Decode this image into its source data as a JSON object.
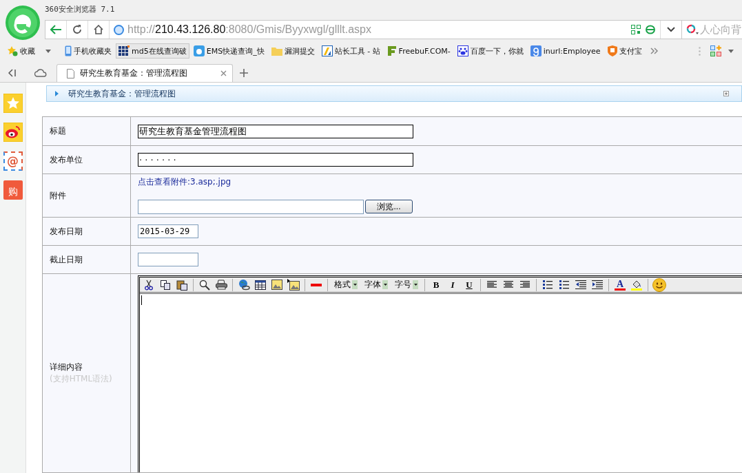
{
  "window": {
    "title": "360安全浏览器 7.1"
  },
  "address_bar": {
    "scheme": "http://",
    "host": "210.43.126.80",
    "path": ":8080/Gmis/Byyxwgl/glllt.aspx"
  },
  "search": {
    "placeholder": "人心向背"
  },
  "bookmarks": [
    {
      "label": "收藏",
      "kind": "favorites",
      "selected": false
    },
    {
      "label": "手机收藏夹",
      "kind": "phone",
      "selected": false
    },
    {
      "label": "md5在线查询破",
      "kind": "grid",
      "selected": true
    },
    {
      "label": "EMS快递查询_快",
      "kind": "ems",
      "selected": false
    },
    {
      "label": "漏洞提交",
      "kind": "folder",
      "selected": false
    },
    {
      "label": "站长工具 - 站",
      "kind": "tool",
      "selected": false
    },
    {
      "label": "FreebuF.COM-",
      "kind": "freebuf",
      "selected": false
    },
    {
      "label": "百度一下，你就",
      "kind": "paw",
      "selected": false
    },
    {
      "label": "inurl:Employee",
      "kind": "google",
      "selected": false
    },
    {
      "label": "支付宝",
      "kind": "shield",
      "selected": false
    }
  ],
  "tabs": [
    {
      "title": "研究生教育基金：管理流程图",
      "selected": true
    }
  ],
  "sidebar": [
    {
      "kind": "star"
    },
    {
      "kind": "weibo"
    },
    {
      "kind": "mail",
      "glyph": "@"
    },
    {
      "kind": "shop",
      "glyph": "购"
    }
  ],
  "breadcrumb": "研究生教育基金：管理流程图",
  "form": [
    {
      "kind": "text",
      "label": "标题",
      "value": "研究生教育基金管理流程图"
    },
    {
      "kind": "text",
      "label": "发布单位",
      "value": "· · · · · · ·"
    },
    {
      "kind": "file",
      "label": "附件",
      "link": "点击查看附件:3.asp;.jpg",
      "button": "浏览..."
    },
    {
      "kind": "date",
      "label": "发布日期",
      "value": "2015-03-29"
    },
    {
      "kind": "date",
      "label": "截止日期"
    },
    {
      "kind": "editor",
      "label": "详细内容",
      "hint": "(支持HTML语法)",
      "dropdowns": [
        "格式",
        "字体",
        "字号"
      ],
      "format_buttons": [
        "B",
        "I",
        "U"
      ],
      "color_letter": "A"
    }
  ]
}
